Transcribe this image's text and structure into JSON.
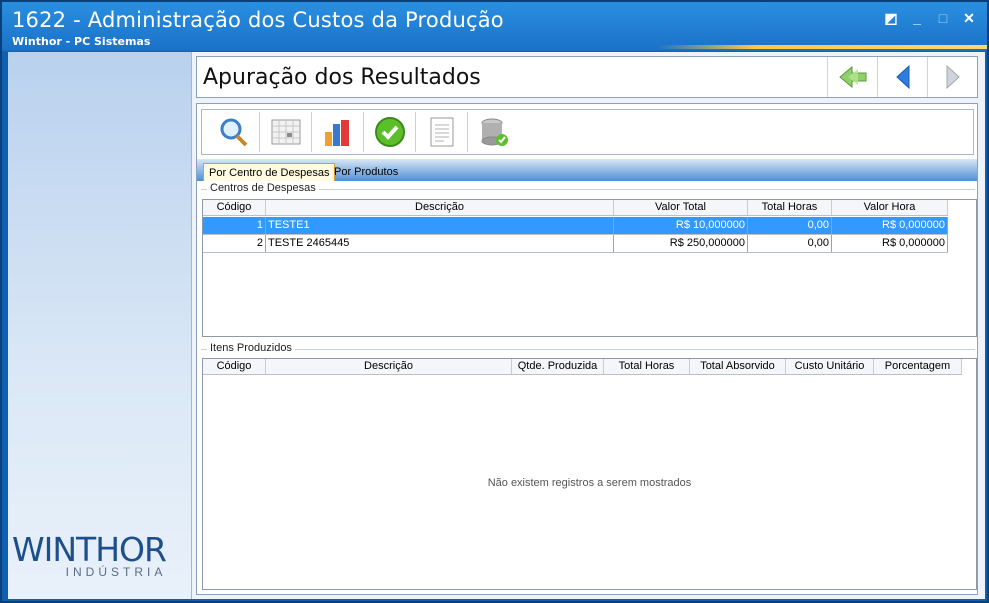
{
  "window": {
    "title": "1622 - Administração dos Custos da Produção",
    "subtitle": "Winthor - PC Sistemas",
    "controls": [
      "◩",
      "_",
      "□",
      "✕"
    ]
  },
  "logo": {
    "main": "WINTHOR",
    "sub": "INDÚSTRIA"
  },
  "header": {
    "title": "Apuração dos Resultados"
  },
  "toolbar": {
    "buttons": [
      "search-icon",
      "calendar-icon",
      "chart-icon",
      "confirm-icon",
      "report-icon",
      "database-icon"
    ]
  },
  "tabs": [
    {
      "label": "Por Centro de Despesas",
      "active": true
    },
    {
      "label": "Por Produtos",
      "active": false
    }
  ],
  "centros": {
    "group_label": "Centros de Despesas",
    "columns": [
      "Código",
      "Descrição",
      "Valor Total",
      "Total Horas",
      "Valor Hora"
    ],
    "rows": [
      {
        "codigo": "1",
        "descricao": "TESTE1",
        "valor_total": "R$ 10,000000",
        "total_horas": "0,00",
        "valor_hora": "R$ 0,000000",
        "selected": true
      },
      {
        "codigo": "2",
        "descricao": "TESTE 2465445",
        "valor_total": "R$ 250,000000",
        "total_horas": "0,00",
        "valor_hora": "R$ 0,000000",
        "selected": false
      }
    ]
  },
  "itens": {
    "group_label": "Itens Produzidos",
    "columns": [
      "Código",
      "Descrição",
      "Qtde. Produzida",
      "Total Horas",
      "Total Absorvido",
      "Custo Unitário",
      "Porcentagem"
    ],
    "empty_message": "Não existem registros a serem mostrados"
  },
  "colors": {
    "title_bar": "#1a72c8",
    "selection": "#3399ff",
    "tab_active": "#fffbe0"
  }
}
